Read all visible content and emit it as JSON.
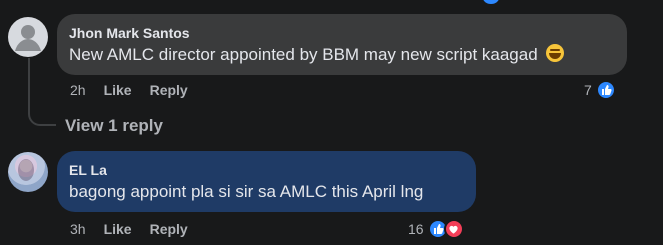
{
  "comments": [
    {
      "author": "Jhon Mark Santos",
      "text": "New AMLC director appointed by BBM may new script kaagad",
      "emoji": "grinning-sweat-emoji",
      "time": "2h",
      "like_label": "Like",
      "reply_label": "Reply",
      "reaction_count": "7",
      "bubble_color": "#3a3b3c"
    },
    {
      "author": "EL La",
      "text": "bagong appoint pla si sir sa AMLC this April lng",
      "time": "3h",
      "like_label": "Like",
      "reply_label": "Reply",
      "reaction_count": "16",
      "bubble_color": "#1f3b66"
    }
  ],
  "thread": {
    "view_replies_label": "View 1 reply"
  },
  "icons": {
    "like": "like-reaction-icon",
    "heart": "heart-reaction-icon"
  },
  "colors": {
    "background": "#18191a",
    "like_blue": "#2d88ff",
    "heart_red": "#f33e58"
  }
}
